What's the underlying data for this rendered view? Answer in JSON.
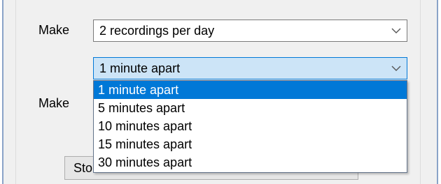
{
  "form": {
    "make_label_1": "Make",
    "recordings_select_value": "2 recordings per day",
    "interval_select_value": "1 minute apart",
    "make_label_2": "Make",
    "stop_button_label": "Sto"
  },
  "dropdown": {
    "options": [
      "1 minute apart",
      "5 minutes apart",
      "10 minutes apart",
      "15 minutes apart",
      "30 minutes apart"
    ],
    "selected_index": 0
  },
  "icons": {
    "combo_chevron": "chevron-down-icon"
  },
  "colors": {
    "selection": "#0078d7",
    "focus_fill": "#cce4f7"
  }
}
